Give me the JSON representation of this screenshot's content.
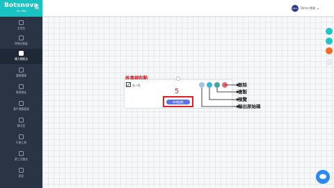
{
  "brand": {
    "name": "Botsnova",
    "sub": "for LINE"
  },
  "user": {
    "avatar_text": "Bots",
    "name": "Demo 帳號"
  },
  "sidebar": {
    "items": [
      {
        "label": "主控台"
      },
      {
        "label": "特殊任務區"
      },
      {
        "label": "權力實能法"
      },
      {
        "label": "選單選單"
      },
      {
        "label": "電視地址"
      },
      {
        "label": "客戶標籤管理"
      },
      {
        "label": "聊天室"
      },
      {
        "label": "行銷工具"
      },
      {
        "label": "第三方整合"
      },
      {
        "label": "設定"
      }
    ]
  },
  "canvas": {
    "annotation_title": "故事線起點",
    "node_label": "進入點",
    "step_number": "5",
    "start_button": "新增起點",
    "labels": {
      "delete": "刪除",
      "copy": "複製",
      "preview": "預覽",
      "code": "輸出原始碼"
    }
  },
  "colors": {
    "brand": "#19c3c1",
    "sidebar": "#2a3445",
    "annotation": "#d71c1c",
    "primary": "#5b73e8"
  }
}
